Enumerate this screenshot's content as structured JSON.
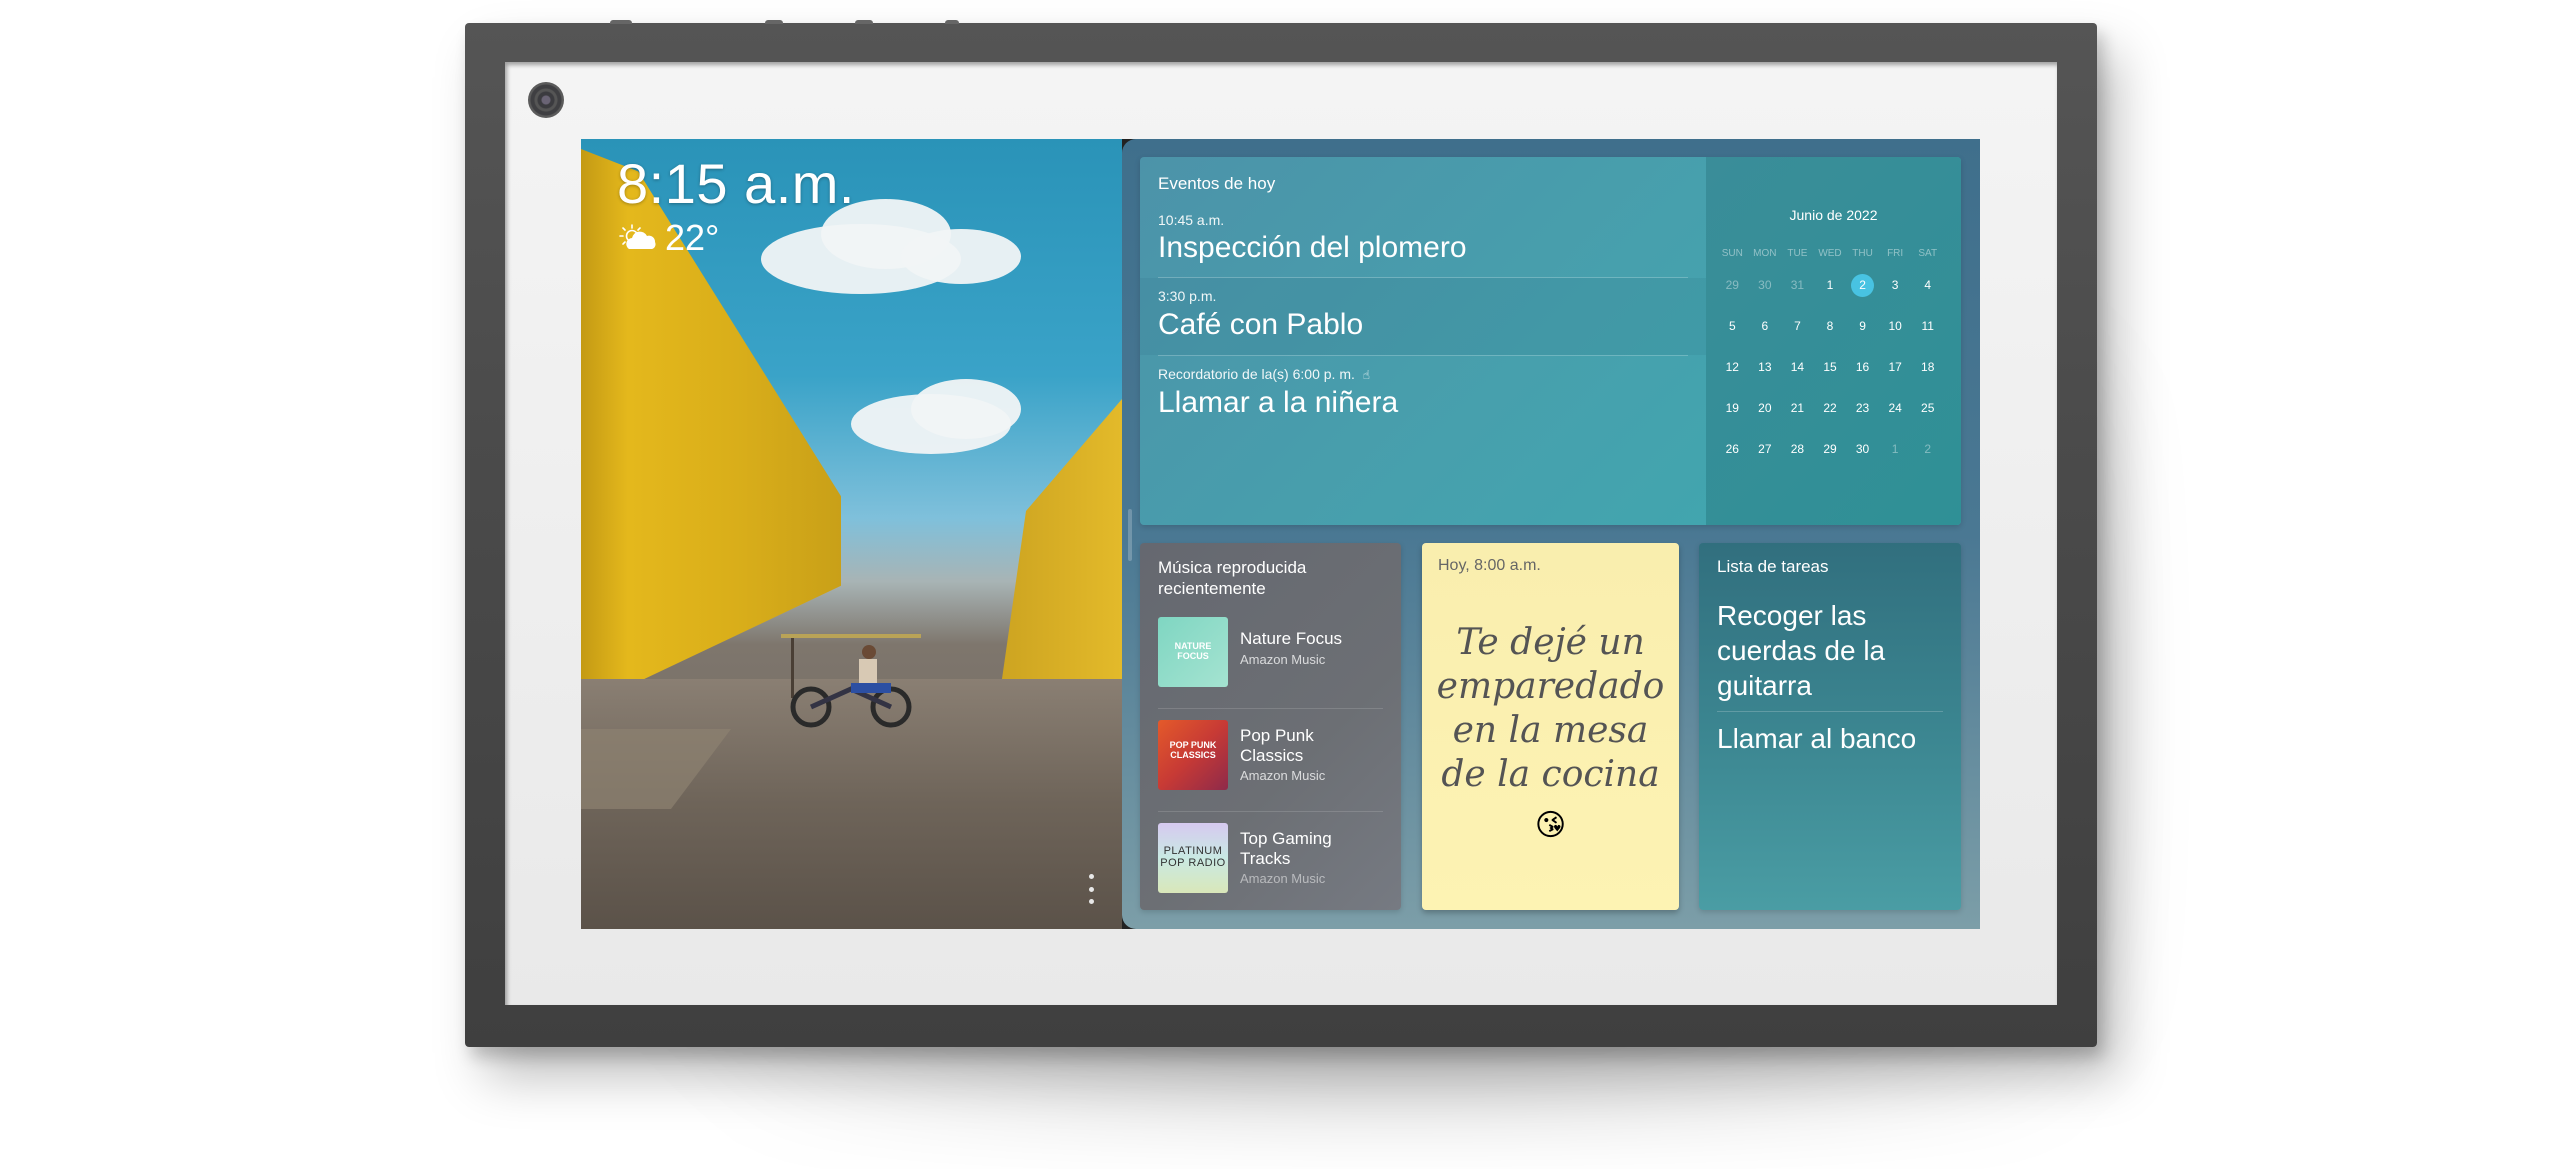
{
  "device": {
    "type": "smart display wall frame",
    "camera": "camera-icon"
  },
  "photo": {
    "clock": "8:15 a.m.",
    "weather": {
      "icon": "partly-cloudy-icon",
      "temperature": "22°"
    },
    "menu_icon": "more-vertical-icon"
  },
  "events": {
    "title": "Eventos de hoy",
    "items": [
      {
        "time": "10:45 a.m.",
        "name": "Inspección del plomero"
      },
      {
        "time": "3:30 p.m.",
        "name": "Café con Pablo"
      },
      {
        "time": "Recordatorio de la(s) 6:00 p. m.",
        "name": "Llamar a la niñera",
        "icon": "hand-pointer-icon"
      }
    ]
  },
  "calendar": {
    "title": "Junio de 2022",
    "weekdays": [
      "SUN",
      "MON",
      "TUE",
      "WED",
      "THU",
      "FRI",
      "SAT"
    ],
    "weeks": [
      [
        "29",
        "30",
        "31",
        "1",
        "2",
        "3",
        "4"
      ],
      [
        "5",
        "6",
        "7",
        "8",
        "9",
        "10",
        "11"
      ],
      [
        "12",
        "13",
        "14",
        "15",
        "16",
        "17",
        "18"
      ],
      [
        "19",
        "20",
        "21",
        "22",
        "23",
        "24",
        "25"
      ],
      [
        "26",
        "27",
        "28",
        "29",
        "30",
        "1",
        "2"
      ]
    ],
    "today": "2",
    "accent_color": "#48c3e2"
  },
  "music": {
    "title": "Música reproducida recientemente",
    "tracks": [
      {
        "name": "Nature Focus",
        "source": "Amazon Music",
        "art_label": "NATURE FOCUS"
      },
      {
        "name": "Pop Punk Classics",
        "source": "Amazon Music",
        "art_label": "POP PUNK CLASSICS"
      },
      {
        "name": "Top Gaming Tracks",
        "source": "Amazon Music",
        "art_label": "PLATINUM POP RADIO"
      }
    ]
  },
  "sticky_note": {
    "time": "Hoy, 8:00 a.m.",
    "text": "Te dejé un emparedado en la mesa de la cocina",
    "emoji": "😘"
  },
  "tasks": {
    "title": "Lista de tareas",
    "items": [
      "Recoger las cuerdas de la guitarra",
      "Llamar al banco"
    ]
  }
}
